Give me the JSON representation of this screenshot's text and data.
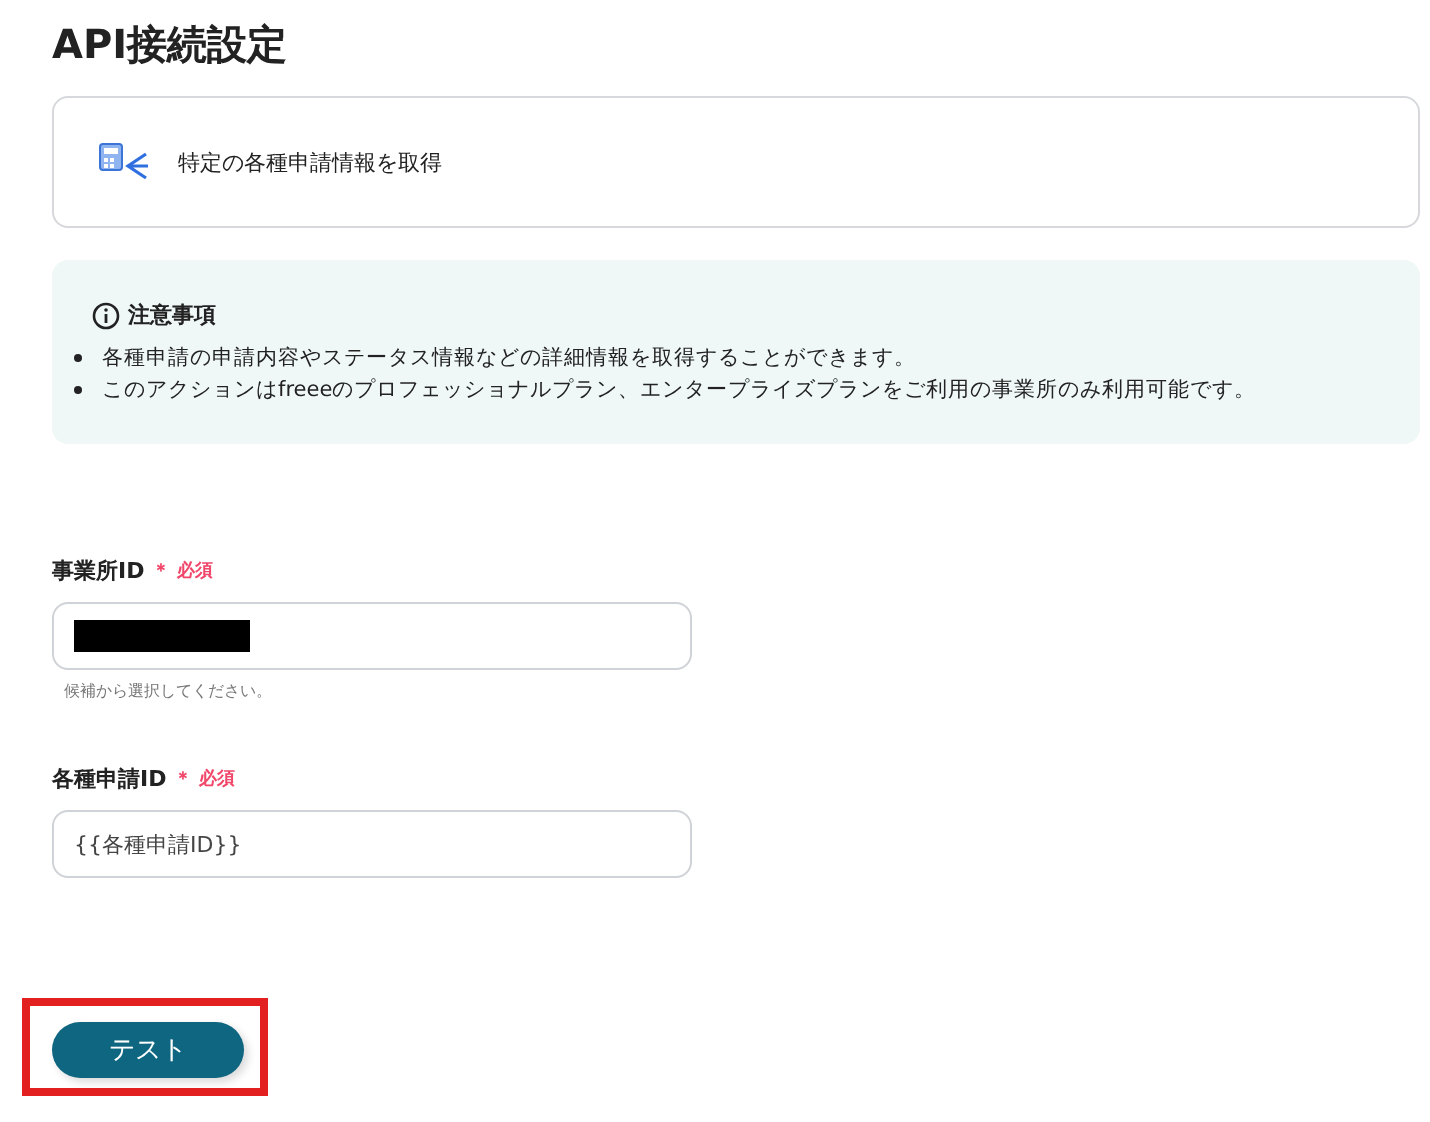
{
  "title": "API接続設定",
  "action": {
    "label": "特定の各種申請情報を取得"
  },
  "notice": {
    "heading": "注意事項",
    "items": [
      "各種申請の申請内容やステータス情報などの詳細情報を取得することができます。",
      "このアクションはfreeeのプロフェッショナルプラン、エンタープライズプランをご利用の事業所のみ利用可能です。"
    ]
  },
  "fields": [
    {
      "label": "事業所ID",
      "required": "＊ 必須",
      "redacted": true,
      "hint": "候補から選択してください。"
    },
    {
      "label": "各種申請ID",
      "required": "＊ 必須",
      "redacted": false,
      "value": "{{各種申請ID}}"
    }
  ],
  "button": {
    "label": "テスト",
    "highlighted": true
  }
}
